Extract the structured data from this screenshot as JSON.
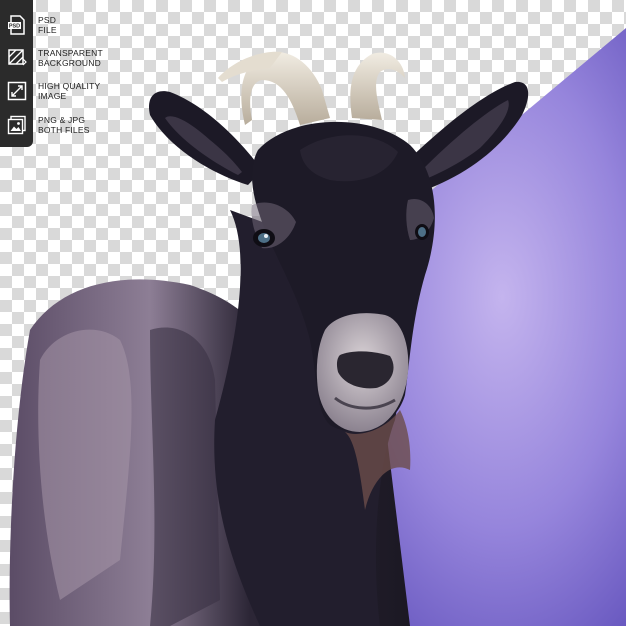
{
  "features": [
    {
      "icon": "psd-file-icon",
      "line1": "PSD",
      "line2": "FILE"
    },
    {
      "icon": "transparent-background-icon",
      "line1": "TRANSPARENT",
      "line2": "BACKGROUND"
    },
    {
      "icon": "high-quality-image-icon",
      "line1": "HIGH QUALITY",
      "line2": "IMAGE"
    },
    {
      "icon": "png-jpg-files-icon",
      "line1": "PNG & JPG",
      "line2": "BOTH FILES"
    }
  ],
  "colors": {
    "badge": "#2b2b2b",
    "purple_light": "#b7a5e6",
    "purple_dark": "#6f5fc2",
    "goat_fur": "#1e1b2a",
    "checker": "#d9d9d9"
  }
}
